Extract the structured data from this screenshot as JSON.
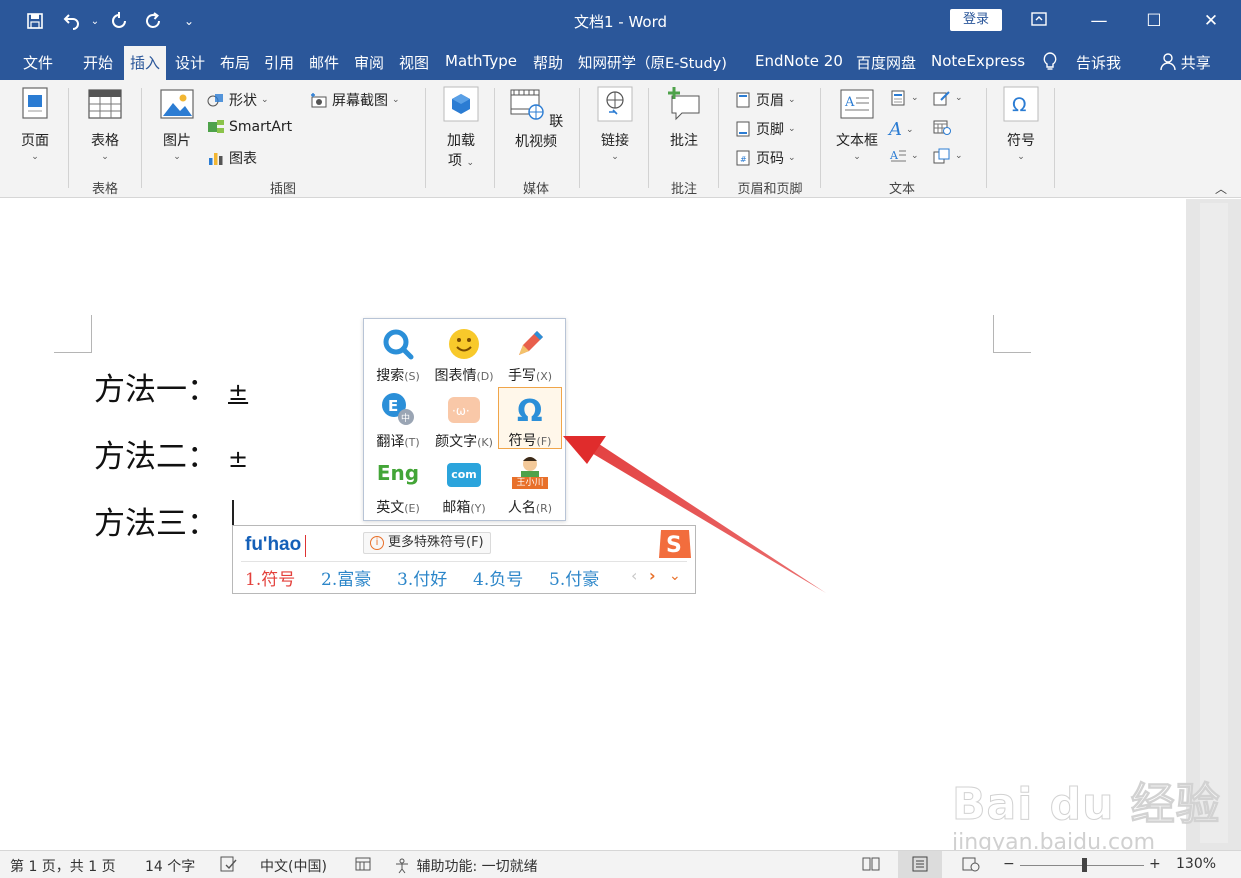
{
  "titlebar": {
    "doc_title": "文档1  -  Word",
    "login": "登录"
  },
  "menu": {
    "tabs": [
      "文件",
      "开始",
      "插入",
      "设计",
      "布局",
      "引用",
      "邮件",
      "审阅",
      "视图",
      "MathType",
      "帮助",
      "知网研学（原E-Study)",
      "EndNote 20",
      "百度网盘",
      "NoteExpress",
      "告诉我",
      "共享"
    ],
    "active_tab": "插入"
  },
  "ribbon": {
    "page": "页面",
    "table": "表格",
    "table_group": "表格",
    "picture": "图片",
    "shapes": "形状",
    "smartart": "SmartArt",
    "chart": "图表",
    "screenshot": "屏幕截图",
    "illustrations_group": "插图",
    "addins": "加载\n项",
    "addins_line1": "加载",
    "addins_line2": "项",
    "online_video": "联机视频",
    "media_group": "媒体",
    "link": "链接",
    "comment": "批注",
    "comment_group": "批注",
    "header": "页眉",
    "footer": "页脚",
    "page_number": "页码",
    "header_footer_group": "页眉和页脚",
    "textbox": "文本框",
    "text_group": "文本",
    "symbol": "符号"
  },
  "document": {
    "lines": [
      {
        "label": "方法一：",
        "symbol": "±"
      },
      {
        "label": "方法二：",
        "symbol": "±"
      },
      {
        "label": "方法三：",
        "symbol": ""
      }
    ]
  },
  "ime_toolbox": {
    "items": [
      {
        "label": "搜索",
        "key": "(S)"
      },
      {
        "label": "图表情",
        "key": "(D)"
      },
      {
        "label": "手写",
        "key": "(X)"
      },
      {
        "label": "翻译",
        "key": "(T)"
      },
      {
        "label": "颜文字",
        "key": "(K)"
      },
      {
        "label": "符号",
        "key": "(F)"
      },
      {
        "label": "英文",
        "key": "(E)"
      },
      {
        "label": "邮箱",
        "key": "(Y)"
      },
      {
        "label": "人名",
        "key": "(R)"
      }
    ],
    "selected": "符号",
    "english_icon_text": "Eng",
    "email_icon_text": "com",
    "name_icon_text": "王小川"
  },
  "ime_bar": {
    "pinyin": "fu'hao",
    "more": "更多特殊符号(F)",
    "candidates": [
      "1.符号",
      "2.富豪",
      "3.付好",
      "4.负号",
      "5.付豪"
    ]
  },
  "statusbar": {
    "page_info": "第 1 页，共 1 页",
    "word_count": "14 个字",
    "language": "中文(中国)",
    "accessibility": "辅助功能: 一切就绪",
    "zoom": "130%"
  },
  "watermark": {
    "brand": "Bai du 经验",
    "url": "jingyan.baidu.com"
  },
  "colors": {
    "accent": "#2b579a",
    "candidate_first": "#e3403b",
    "candidate": "#2c86c9",
    "arrow": "#e02c2c",
    "ime_select": "#f0a54a"
  }
}
